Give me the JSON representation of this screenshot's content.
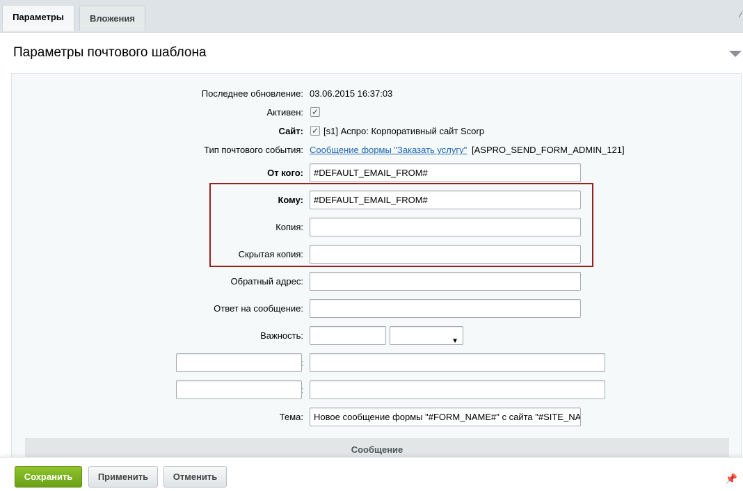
{
  "tabs": [
    {
      "label": "Параметры",
      "active": true
    },
    {
      "label": "Вложения",
      "active": false
    }
  ],
  "panel": {
    "title": "Параметры почтового шаблона"
  },
  "fields": {
    "last_update": {
      "label": "Последнее обновление:",
      "value": "03.06.2015 16:37:03"
    },
    "active": {
      "label": "Активен:",
      "checked": true
    },
    "site": {
      "label": "Сайт:",
      "checked": true,
      "value": "[s1] Аспро: Корпоративный сайт Scorp"
    },
    "event_type": {
      "label": "Тип почтового события:",
      "link": "Сообщение формы \"Заказать услугу\"",
      "code": "[ASPRO_SEND_FORM_ADMIN_121]"
    },
    "from": {
      "label": "От кого:",
      "value": "#DEFAULT_EMAIL_FROM#"
    },
    "to": {
      "label": "Кому:",
      "value": "#DEFAULT_EMAIL_FROM#"
    },
    "cc": {
      "label": "Копия:",
      "value": ""
    },
    "bcc": {
      "label": "Скрытая копия:",
      "value": ""
    },
    "reply_address": {
      "label": "Обратный адрес:",
      "value": ""
    },
    "reply_to": {
      "label": "Ответ на сообщение:",
      "value": ""
    },
    "priority": {
      "label": "Важность:",
      "value": "",
      "select_value": ""
    },
    "header_sep": ":",
    "subject": {
      "label": "Тема:",
      "value": "Новое сообщение формы \"#FORM_NAME#\" с сайта \"#SITE_NAME#\""
    }
  },
  "section": {
    "title": "Сообщение"
  },
  "buttons": {
    "save": "Сохранить",
    "apply": "Применить",
    "cancel": "Отменить"
  },
  "icons": {
    "checkbox": "✓",
    "select_arrow": "▼",
    "pin": "pin-icon"
  },
  "colors": {
    "accent_green": "#7bb521",
    "link": "#2067b0",
    "highlight_border": "#9a1f1f"
  }
}
